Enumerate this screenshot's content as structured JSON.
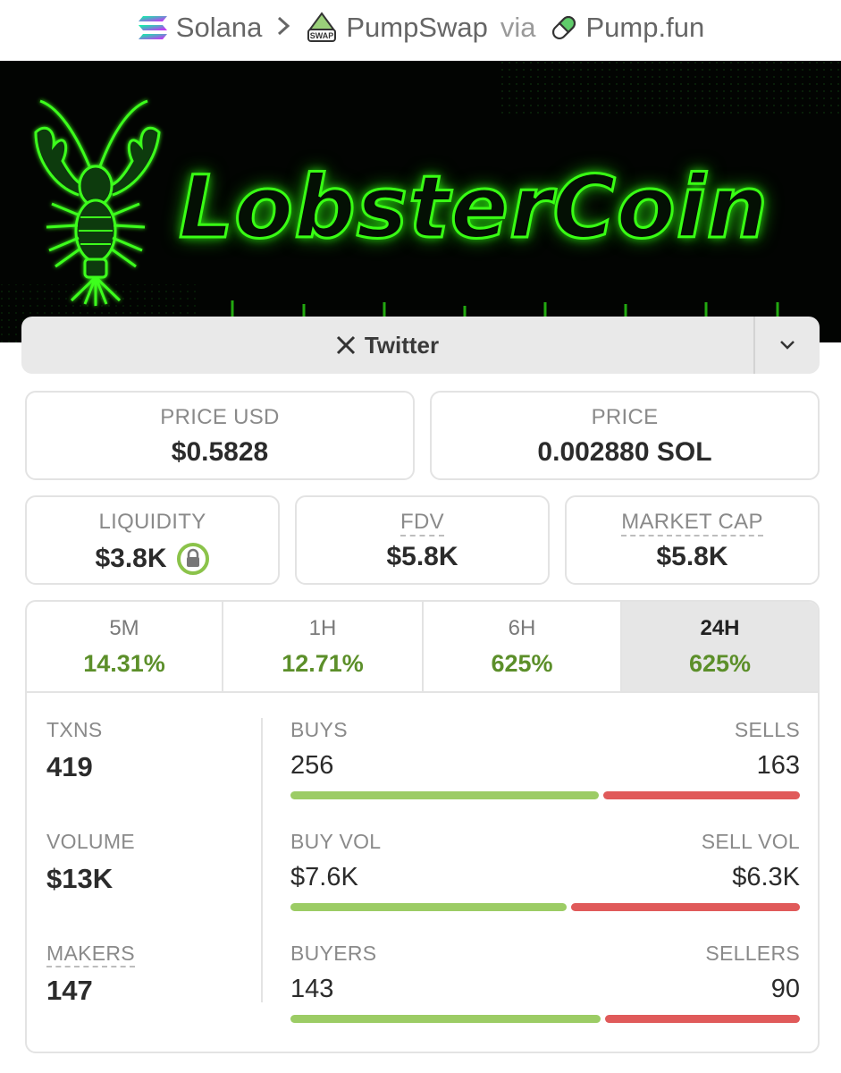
{
  "breadcrumb": {
    "chain": "Solana",
    "dex": "PumpSwap",
    "via": "via",
    "launchpad": "Pump.fun",
    "dex_badge": "SWAP"
  },
  "banner": {
    "title": "LobsterCoin",
    "glow_color": "#39ff14"
  },
  "social": {
    "label": "Twitter",
    "icon": "x-logo-icon"
  },
  "price": {
    "usd_label": "PRICE USD",
    "usd_value": "$0.5828",
    "native_label": "PRICE",
    "native_value": "0.002880 SOL"
  },
  "metrics": {
    "liquidity_label": "LIQUIDITY",
    "liquidity_value": "$3.8K",
    "fdv_label": "FDV",
    "fdv_value": "$5.8K",
    "mcap_label": "MARKET CAP",
    "mcap_value": "$5.8K"
  },
  "timeframes": [
    {
      "label": "5M",
      "change": "14.31%",
      "active": false
    },
    {
      "label": "1H",
      "change": "12.71%",
      "active": false
    },
    {
      "label": "6H",
      "change": "625%",
      "active": false
    },
    {
      "label": "24H",
      "change": "625%",
      "active": true
    }
  ],
  "stats": {
    "txns_label": "TXNS",
    "txns_value": "419",
    "volume_label": "VOLUME",
    "volume_value": "$13K",
    "makers_label": "MAKERS",
    "makers_value": "147"
  },
  "split": [
    {
      "left_label": "BUYS",
      "left_value": "256",
      "right_label": "SELLS",
      "right_value": "163",
      "buy_fraction": 0.611
    },
    {
      "left_label": "BUY VOL",
      "left_value": "$7.6K",
      "right_label": "SELL VOL",
      "right_value": "$6.3K",
      "buy_fraction": 0.547
    },
    {
      "left_label": "BUYERS",
      "left_value": "143",
      "right_label": "SELLERS",
      "right_value": "90",
      "buy_fraction": 0.614
    }
  ],
  "colors": {
    "positive": "#5c8f2a",
    "buy_bar": "#9ccc65",
    "sell_bar": "#e05a5a",
    "lock_ring": "#8bc34a"
  }
}
